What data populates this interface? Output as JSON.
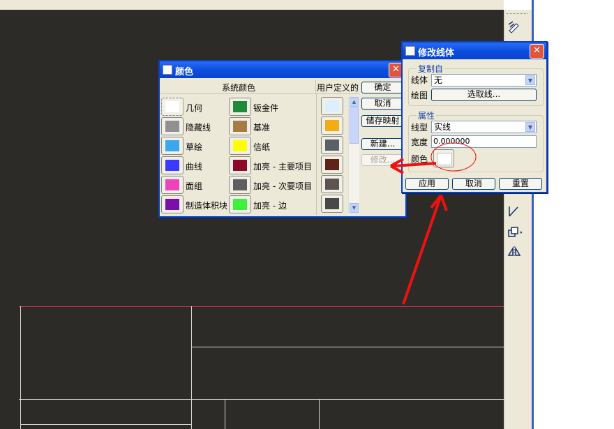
{
  "color_dialog": {
    "title": "颜色",
    "header_system": "系统颜色",
    "header_user": "用户定义的",
    "system_colors": [
      {
        "label": "几何",
        "color": "#ffffff"
      },
      {
        "label": "钣金件",
        "color": "#1e8a3a"
      },
      {
        "label": "隐藏线",
        "color": "#909090"
      },
      {
        "label": "基准",
        "color": "#a97a44"
      },
      {
        "label": "草绘",
        "color": "#3aa7ee"
      },
      {
        "label": "信纸",
        "color": "#ffff00"
      },
      {
        "label": "曲线",
        "color": "#3a3aff"
      },
      {
        "label": "加亮 - 主要项目",
        "color": "#8a0a28"
      },
      {
        "label": "面组",
        "color": "#ee44bb"
      },
      {
        "label": "加亮 - 次要项目",
        "color": "#5e5e5e"
      },
      {
        "label": "制造体积块",
        "color": "#7a10a8"
      },
      {
        "label": "加亮 - 边",
        "color": "#3cf03c"
      }
    ],
    "user_colors": [
      "#ddeeff",
      "#f2ac14",
      "#5a6068",
      "#5e2418",
      "#5e5452",
      "#484848"
    ],
    "buttons": {
      "ok": "确定",
      "cancel": "取消",
      "save_map": "储存映射",
      "new": "新建...",
      "modify": "修改..."
    }
  },
  "linestyle_dialog": {
    "title": "修改线体",
    "group_copy": "复制自",
    "linestyle_label": "线体",
    "linestyle_value": "无",
    "draw_label": "绘图",
    "select_line_button": "选取线...",
    "group_props": "属性",
    "linetype_label": "线型",
    "linetype_value": "实线",
    "width_label": "宽度",
    "width_value": "0.000000",
    "color_label": "颜色",
    "color_value": "#ffffff",
    "buttons": {
      "apply": "应用",
      "cancel": "取消",
      "reset": "重置"
    }
  },
  "annotation_color": "#ee1111",
  "toolbar_icons": [
    "pencil-edit-icon",
    "arrow-up-icon",
    "line-tool-icon",
    "copy-icon",
    "mirror-icon"
  ]
}
